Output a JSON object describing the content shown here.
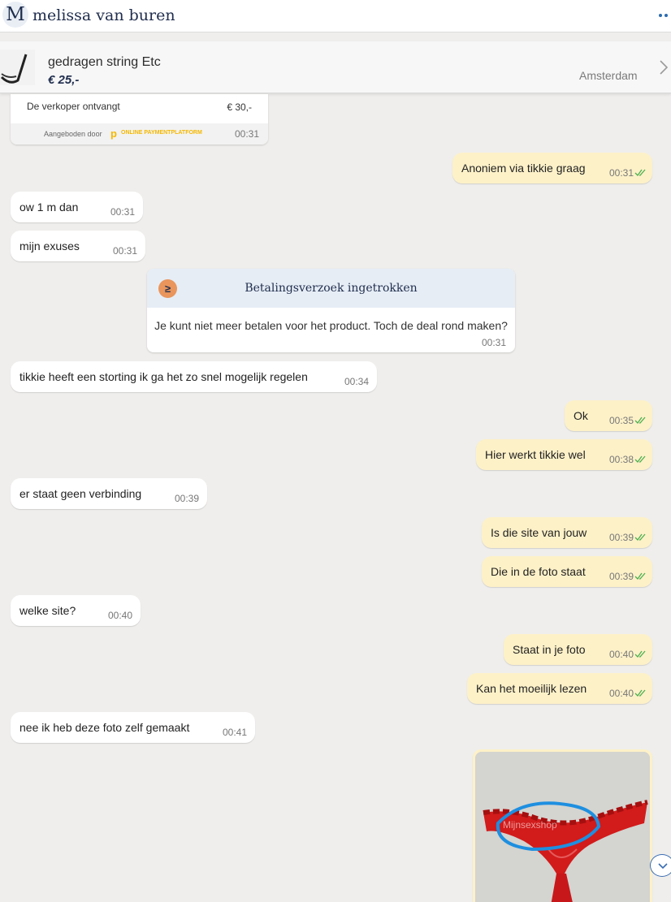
{
  "header": {
    "avatar_letter": "M",
    "contact_name": "melissa van buren"
  },
  "listing": {
    "title": "gedragen string Etc",
    "price": "€ 25,-",
    "location": "Amsterdam"
  },
  "offer": {
    "label": "De verkoper ontvangt",
    "amount": "€ 30,-",
    "offered_by": "Aangeboden door",
    "platform_name": "ONLINE PAYMENTPLATFORM",
    "time": "00:31"
  },
  "system_card": {
    "title": "Betalingsverzoek ingetrokken",
    "body": "Je kunt niet meer betalen voor het product. Toch de deal rond maken?",
    "time": "00:31"
  },
  "messages": [
    {
      "direction": "out",
      "text": "Anoniem via tikkie graag",
      "time": "00:31"
    },
    {
      "direction": "in",
      "text": "ow 1 m dan",
      "time": "00:31"
    },
    {
      "direction": "in",
      "text": "mijn exuses",
      "time": "00:31"
    },
    {
      "direction": "in",
      "text": "tikkie heeft een storting ik ga het zo snel mogelijk regelen",
      "time": "00:34"
    },
    {
      "direction": "out",
      "text": "Ok",
      "time": "00:35"
    },
    {
      "direction": "out",
      "text": "Hier werkt tikkie wel",
      "time": "00:38"
    },
    {
      "direction": "in",
      "text": "er staat geen verbinding",
      "time": "00:39"
    },
    {
      "direction": "out",
      "text": "Is die site van jouw",
      "time": "00:39"
    },
    {
      "direction": "out",
      "text": "Die in de foto staat",
      "time": "00:39"
    },
    {
      "direction": "in",
      "text": "welke site?",
      "time": "00:40"
    },
    {
      "direction": "out",
      "text": "Staat in je foto",
      "time": "00:40"
    },
    {
      "direction": "out",
      "text": "Kan het moeilijk lezen",
      "time": "00:40"
    },
    {
      "direction": "in",
      "text": "nee ik heb deze foto zelf gemaakt",
      "time": "00:41"
    }
  ],
  "photo": {
    "watermark": "Mijnsexshop"
  },
  "colors": {
    "brand_navy": "#1f2d4d",
    "incoming_bubble": "#ffffff",
    "outgoing_bubble": "#fdf1c8",
    "read_tick": "#4caf50",
    "background": "#efeeec"
  },
  "icons": {
    "more": "more-dots-icon",
    "listing_chevron": "chevron-right-icon",
    "system_card": "payment-icon",
    "read_receipt": "double-check-icon",
    "scroll_down": "chevron-down-icon"
  }
}
